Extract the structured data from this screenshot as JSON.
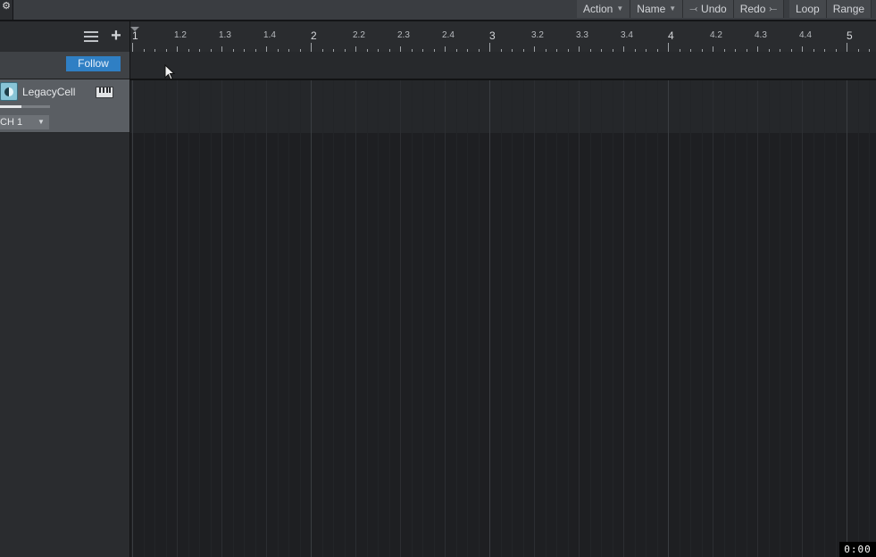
{
  "toolbar": {
    "gear_icon": "gear-icon",
    "action_label": "Action",
    "name_label": "Name",
    "undo_label": "Undo",
    "redo_label": "Redo",
    "loop_label": "Loop",
    "range_label": "Range"
  },
  "track_panel": {
    "follow_label": "Follow",
    "track": {
      "name": "LegacyCell",
      "channel": "CH 1",
      "volume_fraction": 0.43
    }
  },
  "ruler": {
    "labels": [
      "1",
      "1.2",
      "1.3",
      "1.4",
      "2",
      "2.2",
      "2.3",
      "2.4",
      "3",
      "3.2",
      "3.3",
      "3.4",
      "4",
      "4.2",
      "4.3",
      "4.4",
      "5"
    ]
  },
  "time_display": "0:00",
  "colors": {
    "accent": "#2f7fc4",
    "monitor": "#88c4d6"
  }
}
